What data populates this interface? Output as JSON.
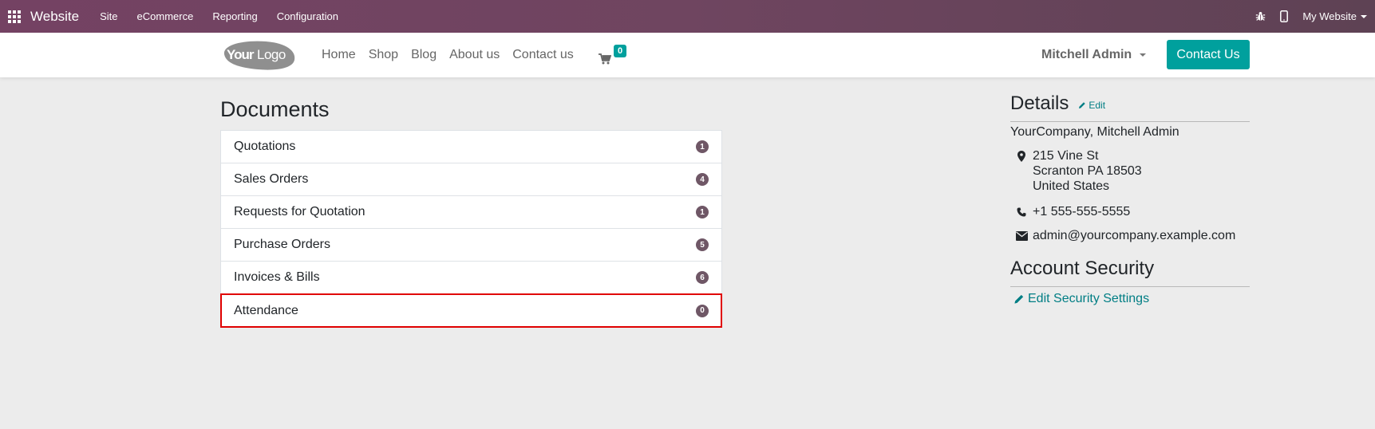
{
  "topbar": {
    "app_name": "Website",
    "menus": [
      "Site",
      "eCommerce",
      "Reporting",
      "Configuration"
    ],
    "website_selector": "My Website",
    "icons": {
      "apps": "grid-icon",
      "debug": "bug-icon",
      "mobile": "mobile-icon"
    }
  },
  "header": {
    "logo_text": "YourLogo",
    "nav": [
      "Home",
      "Shop",
      "Blog",
      "About us",
      "Contact us"
    ],
    "cart_count": "0",
    "user_name": "Mitchell Admin",
    "cta_label": "Contact Us"
  },
  "documents": {
    "title": "Documents",
    "items": [
      {
        "label": "Quotations",
        "count": "1"
      },
      {
        "label": "Sales Orders",
        "count": "4"
      },
      {
        "label": "Requests for Quotation",
        "count": "1"
      },
      {
        "label": "Purchase Orders",
        "count": "5"
      },
      {
        "label": "Invoices & Bills",
        "count": "6"
      },
      {
        "label": "Attendance",
        "count": "0",
        "highlighted": true
      }
    ]
  },
  "details": {
    "title": "Details",
    "edit_label": "Edit",
    "company": "YourCompany, Mitchell Admin",
    "address": [
      "215 Vine St",
      "Scranton PA 18503",
      "United States"
    ],
    "phone": "+1 555-555-5555",
    "email": "admin@yourcompany.example.com"
  },
  "security": {
    "title": "Account Security",
    "link_label": "Edit Security Settings"
  },
  "colors": {
    "topbar": "#714B67",
    "primary": "#00A09D",
    "link": "#017e84",
    "badge": "#6f5766",
    "highlight": "#e00000",
    "background": "#ececec"
  }
}
